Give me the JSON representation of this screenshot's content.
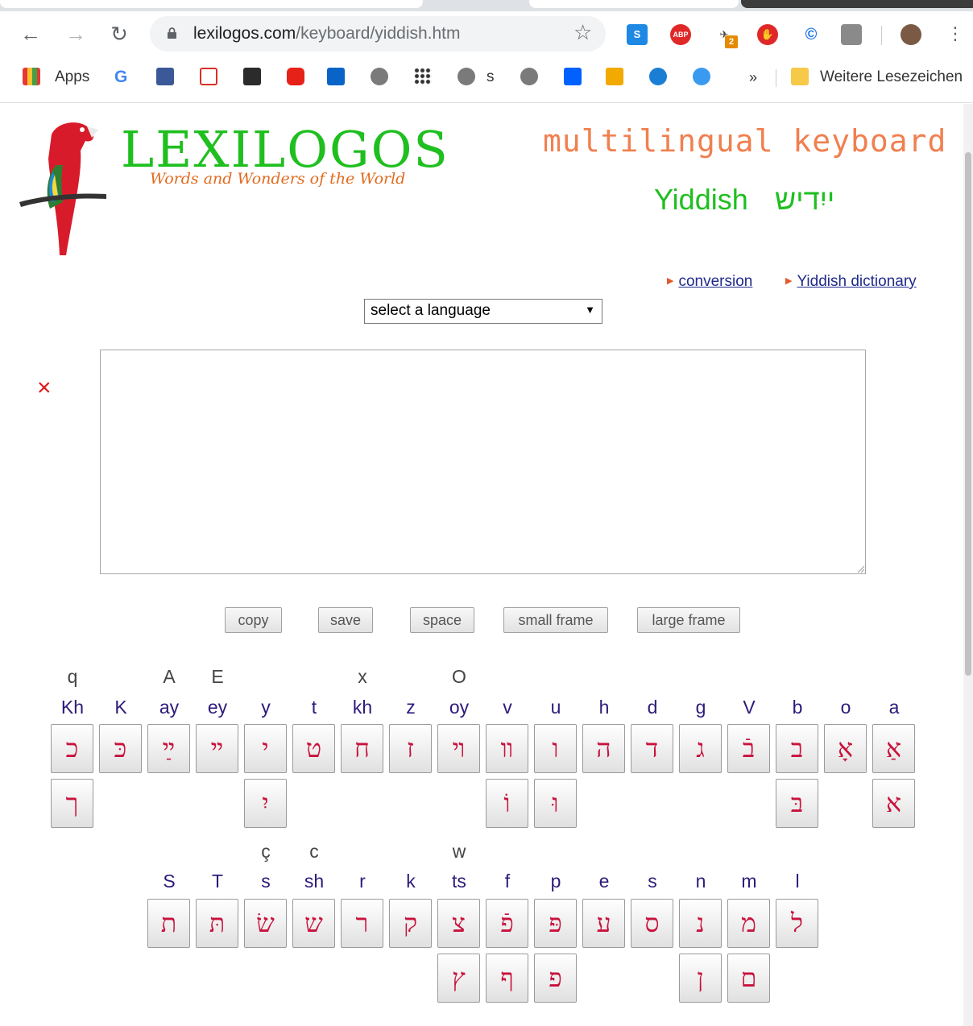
{
  "browser": {
    "url_host": "lexilogos.com",
    "url_path": "/keyboard/yiddish.htm",
    "bookmarks": {
      "apps_label": "Apps",
      "s_label": "s",
      "more_label": "»",
      "other_label": "Weitere Lesezeichen"
    },
    "extensions": {
      "s_label": "S",
      "abp_label": "ABP",
      "badge_count": "2"
    }
  },
  "header": {
    "logo_word": "LEXILOGOS",
    "logo_tagline": "Words and Wonders of the World",
    "title": "multilingual keyboard",
    "language_latin": "Yiddish",
    "language_native": "ייִדיש"
  },
  "links": {
    "conversion": "conversion",
    "dictionary": "Yiddish dictionary"
  },
  "language_select": {
    "value": "select a language"
  },
  "clear_symbol": "×",
  "buttons": {
    "copy": "copy",
    "save": "save",
    "space": "space",
    "small_frame": "small frame",
    "large_frame": "large frame"
  },
  "keyboard": {
    "row1": [
      {
        "top": "q",
        "label": "Kh",
        "keys": [
          "כ",
          "ך"
        ]
      },
      {
        "top": "",
        "label": "K",
        "keys": [
          "כּ"
        ]
      },
      {
        "top": "A",
        "label": "ay",
        "keys": [
          "ײַ"
        ]
      },
      {
        "top": "E",
        "label": "ey",
        "keys": [
          "ײ"
        ]
      },
      {
        "top": "",
        "label": "y",
        "keys": [
          "י",
          "יִ"
        ]
      },
      {
        "top": "",
        "label": "t",
        "keys": [
          "ט"
        ]
      },
      {
        "top": "x",
        "label": "kh",
        "keys": [
          "ח"
        ]
      },
      {
        "top": "",
        "label": "z",
        "keys": [
          "ז"
        ]
      },
      {
        "top": "O",
        "label": "oy",
        "keys": [
          "ױ"
        ]
      },
      {
        "top": "",
        "label": "v",
        "keys": [
          "װ",
          "וֹ"
        ]
      },
      {
        "top": "",
        "label": "u",
        "keys": [
          "ו",
          "וּ"
        ]
      },
      {
        "top": "",
        "label": "h",
        "keys": [
          "ה"
        ]
      },
      {
        "top": "",
        "label": "d",
        "keys": [
          "ד"
        ]
      },
      {
        "top": "",
        "label": "g",
        "keys": [
          "ג"
        ]
      },
      {
        "top": "",
        "label": "V",
        "keys": [
          "בֿ"
        ]
      },
      {
        "top": "",
        "label": "b",
        "keys": [
          "ב",
          "בּ"
        ]
      },
      {
        "top": "",
        "label": "o",
        "keys": [
          "אָ"
        ]
      },
      {
        "top": "",
        "label": "a",
        "keys": [
          "אַ",
          "א"
        ]
      }
    ],
    "row2": [
      {
        "top": "",
        "label": "S",
        "keys": [
          "ת"
        ]
      },
      {
        "top": "",
        "label": "T",
        "keys": [
          "תּ"
        ]
      },
      {
        "top": "ç",
        "label": "s",
        "keys": [
          "שׂ"
        ]
      },
      {
        "top": "c",
        "label": "sh",
        "keys": [
          "ש"
        ]
      },
      {
        "top": "",
        "label": "r",
        "keys": [
          "ר"
        ]
      },
      {
        "top": "",
        "label": "k",
        "keys": [
          "ק"
        ]
      },
      {
        "top": "w",
        "label": "ts",
        "keys": [
          "צ",
          "ץ"
        ]
      },
      {
        "top": "",
        "label": "f",
        "keys": [
          "פֿ",
          "ף"
        ]
      },
      {
        "top": "",
        "label": "p",
        "keys": [
          "פּ",
          "פ"
        ]
      },
      {
        "top": "",
        "label": "e",
        "keys": [
          "ע"
        ]
      },
      {
        "top": "",
        "label": "s",
        "keys": [
          "ס"
        ]
      },
      {
        "top": "",
        "label": "n",
        "keys": [
          "נ",
          "ן"
        ]
      },
      {
        "top": "",
        "label": "m",
        "keys": [
          "מ",
          "ם"
        ]
      },
      {
        "top": "",
        "label": "l",
        "keys": [
          "ל"
        ]
      }
    ]
  }
}
